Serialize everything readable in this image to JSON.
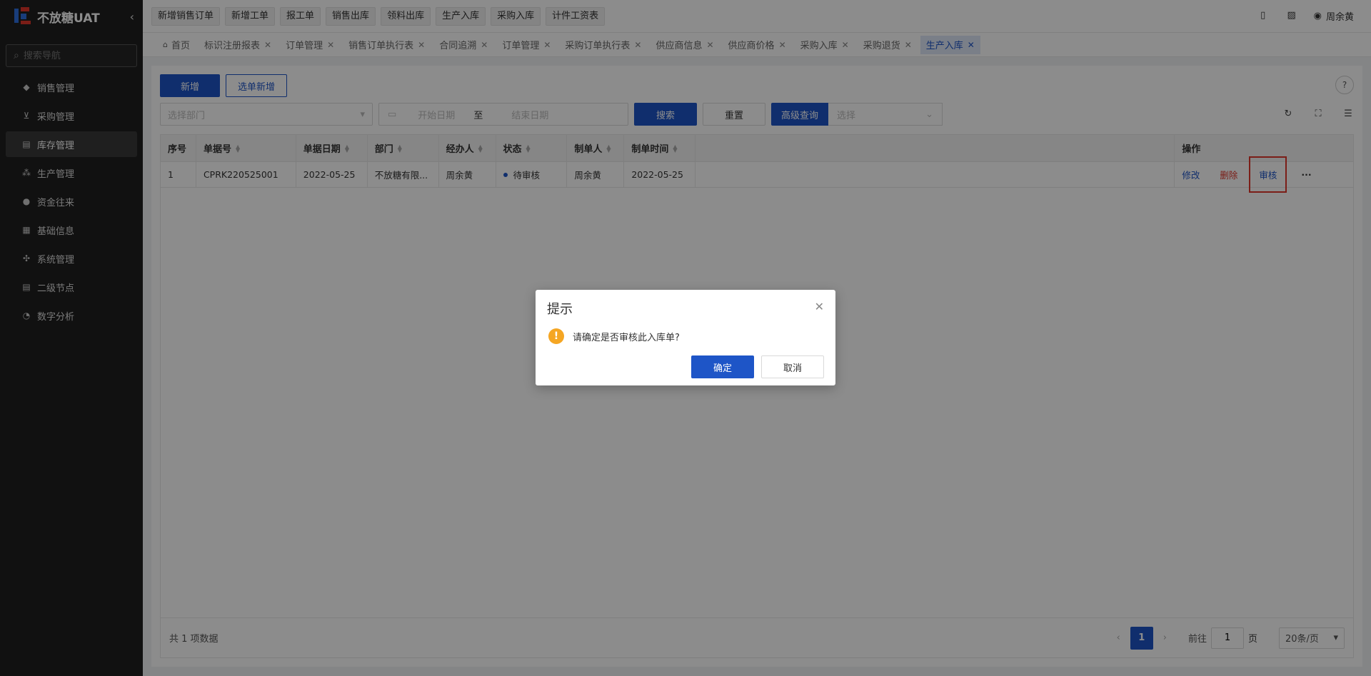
{
  "app": {
    "title": "不放糖UAT"
  },
  "sidebar": {
    "search_placeholder": "搜索导航",
    "items": [
      {
        "label": "销售管理",
        "icon": "tag-icon"
      },
      {
        "label": "采购管理",
        "icon": "cart-icon"
      },
      {
        "label": "库存管理",
        "icon": "inventory-icon",
        "active": true
      },
      {
        "label": "生产管理",
        "icon": "production-icon"
      },
      {
        "label": "资金往来",
        "icon": "money-icon"
      },
      {
        "label": "基础信息",
        "icon": "grid-icon"
      },
      {
        "label": "系统管理",
        "icon": "settings-icon"
      },
      {
        "label": "二级节点",
        "icon": "document-icon"
      },
      {
        "label": "数字分析",
        "icon": "pie-chart-icon"
      }
    ]
  },
  "topbar": {
    "quick_buttons": [
      "新增销售订单",
      "新增工单",
      "报工单",
      "销售出库",
      "领料出库",
      "生产入库",
      "采购入库",
      "计件工资表"
    ],
    "user_name": "周余黄"
  },
  "tabs": [
    {
      "label": "首页",
      "closable": false
    },
    {
      "label": "标识注册报表",
      "closable": true
    },
    {
      "label": "订单管理",
      "closable": true
    },
    {
      "label": "销售订单执行表",
      "closable": true
    },
    {
      "label": "合同追溯",
      "closable": true
    },
    {
      "label": "订单管理",
      "closable": true
    },
    {
      "label": "采购订单执行表",
      "closable": true
    },
    {
      "label": "供应商信息",
      "closable": true
    },
    {
      "label": "供应商价格",
      "closable": true
    },
    {
      "label": "采购入库",
      "closable": true
    },
    {
      "label": "采购退货",
      "closable": true
    },
    {
      "label": "生产入库",
      "closable": true,
      "active": true
    }
  ],
  "toolbar": {
    "add_label": "新增",
    "select_add_label": "选单新增",
    "dept_placeholder": "选择部门",
    "start_date_placeholder": "开始日期",
    "date_separator": "至",
    "end_date_placeholder": "结束日期",
    "search_label": "搜索",
    "reset_label": "重置",
    "advanced_label": "高级查询",
    "advanced_select_placeholder": "选择"
  },
  "table": {
    "headers": {
      "index": "序号",
      "doc_no": "单据号",
      "doc_date": "单据日期",
      "dept": "部门",
      "handler": "经办人",
      "status": "状态",
      "creator": "制单人",
      "created_at": "制单时间",
      "actions": "操作"
    },
    "rows": [
      {
        "index": "1",
        "doc_no": "CPRK220525001",
        "doc_date": "2022-05-25",
        "dept": "不放糖有限...",
        "handler": "周余黄",
        "status": "待审核",
        "creator": "周余黄",
        "created_at": "2022-05-25",
        "edit": "修改",
        "delete": "删除",
        "audit": "审核"
      }
    ],
    "total_text": "共 1 项数据"
  },
  "pagination": {
    "current_page": "1",
    "goto_label": "前往",
    "goto_value": "1",
    "page_unit": "页",
    "page_size": "20条/页"
  },
  "dialog": {
    "title": "提示",
    "message": "请确定是否审核此入库单?",
    "ok_label": "确定",
    "cancel_label": "取消"
  },
  "colors": {
    "primary": "#1e55c7",
    "danger": "#e0352b",
    "warning": "#f5a623",
    "sidebar_bg": "#1f1f1f"
  }
}
